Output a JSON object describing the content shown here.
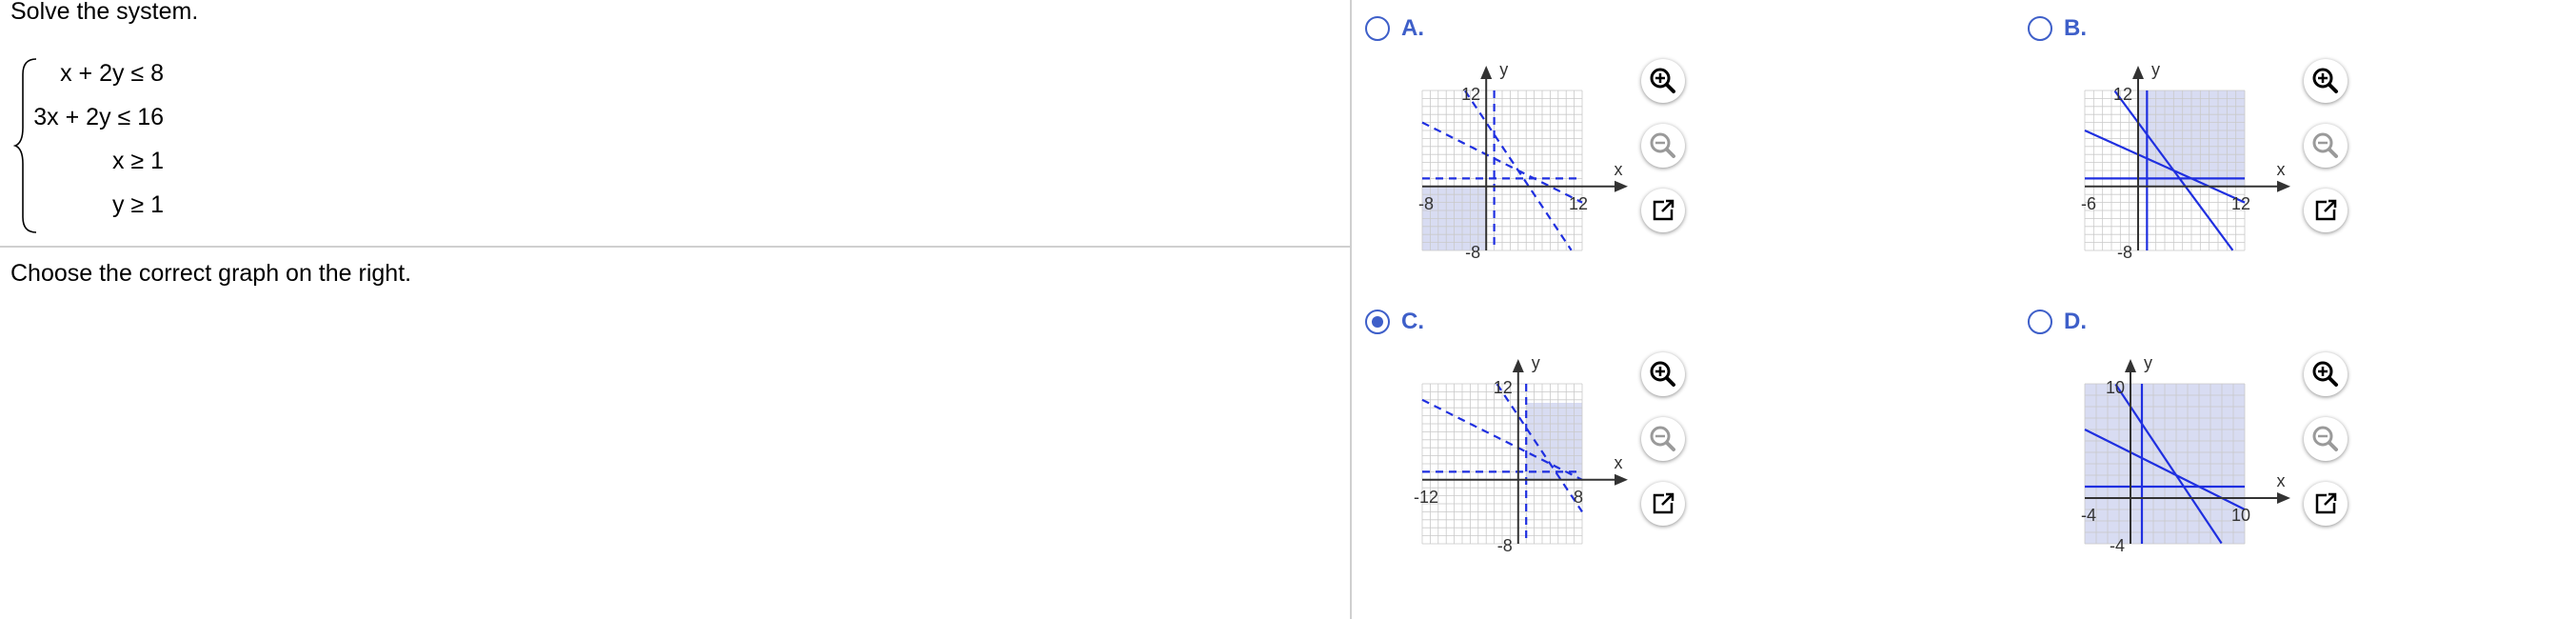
{
  "problem": {
    "prompt": "Solve the system.",
    "inequalities": [
      "x + 2y ≤ 8",
      "3x + 2y ≤ 16",
      "x ≥ 1",
      "y ≥ 1"
    ],
    "instruction": "Choose the correct graph on the right."
  },
  "colors": {
    "accent": "#3e5fc9",
    "line": "#1f2fe0",
    "shade": "#d8dcf2",
    "grid": "#c9c9c9"
  },
  "options": [
    {
      "label": "A.",
      "selected": false,
      "axis_x": "x",
      "axis_y": "y",
      "xmin": -8,
      "xmax": 12,
      "ymin": -8,
      "ymax": 12,
      "xmin_label": "-8",
      "xmax_label": "12",
      "ymin_label": "-8",
      "ymax_label": "12",
      "line_style": "dashed",
      "shade": "bottom-left"
    },
    {
      "label": "B.",
      "selected": false,
      "axis_x": "x",
      "axis_y": "y",
      "xmin": -6,
      "xmax": 12,
      "ymin": -8,
      "ymax": 12,
      "xmin_label": "-6",
      "xmax_label": "12",
      "ymin_label": "-8",
      "ymax_label": "12",
      "line_style": "solid",
      "shade": "top-right"
    },
    {
      "label": "C.",
      "selected": true,
      "axis_x": "x",
      "axis_y": "y",
      "xmin": -12,
      "xmax": 8,
      "ymin": -8,
      "ymax": 12,
      "xmin_label": "-12",
      "xmax_label": "8",
      "ymin_label": "-8",
      "ymax_label": "12",
      "line_style": "dashed",
      "shade": "right"
    },
    {
      "label": "D.",
      "selected": false,
      "axis_x": "x",
      "axis_y": "y",
      "xmin": -4,
      "xmax": 10,
      "ymin": -4,
      "ymax": 10,
      "xmin_label": "-4",
      "xmax_label": "10",
      "ymin_label": "-4",
      "ymax_label": "10",
      "line_style": "solid",
      "shade": "outside"
    }
  ],
  "tools": [
    "zoom-in-icon",
    "zoom-out-icon",
    "open-external-icon"
  ]
}
